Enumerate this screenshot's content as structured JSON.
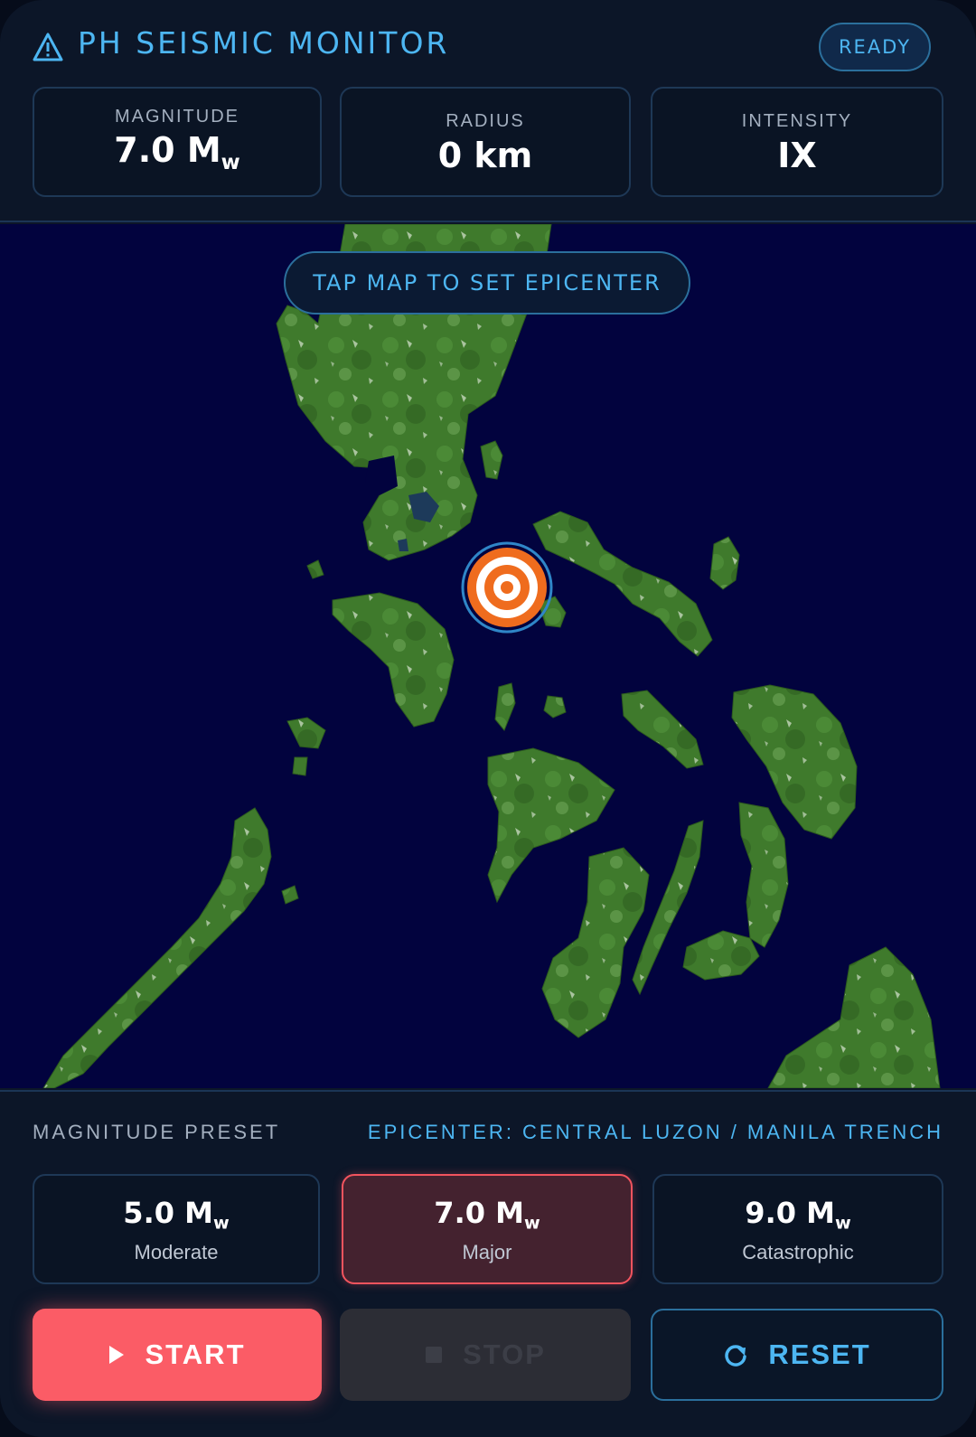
{
  "header": {
    "title": "PH SEISMIC MONITOR",
    "status": "READY",
    "title_icon": "warning-triangle-icon"
  },
  "stats": {
    "magnitude": {
      "label": "MAGNITUDE",
      "value": "7.0 M",
      "unit_sub": "w"
    },
    "radius": {
      "label": "RADIUS",
      "value": "0 km"
    },
    "intensity": {
      "label": "INTENSITY",
      "value": "IX"
    }
  },
  "map": {
    "hint": "TAP MAP TO SET EPICENTER",
    "marker_icon": "epicenter-target-icon"
  },
  "controls": {
    "preset_label": "MAGNITUDE PRESET",
    "epicenter_label": "EPICENTER: CENTRAL LUZON / MANILA TRENCH",
    "presets": [
      {
        "magnitude": "5.0 M",
        "unit_sub": "w",
        "description": "Moderate",
        "selected": false
      },
      {
        "magnitude": "7.0 M",
        "unit_sub": "w",
        "description": "Major",
        "selected": true
      },
      {
        "magnitude": "9.0 M",
        "unit_sub": "w",
        "description": "Catastrophic",
        "selected": false
      }
    ],
    "start_label": "START",
    "stop_label": "STOP",
    "reset_label": "RESET",
    "start_icon": "play-icon",
    "stop_icon": "stop-icon",
    "reset_icon": "refresh-icon"
  },
  "colors": {
    "accent": "#4db6f2",
    "danger": "#fb5c66",
    "background": "#0c1628",
    "sea": "#02033e",
    "land": "#3f7a2c",
    "marker": "#ef6c1e"
  }
}
